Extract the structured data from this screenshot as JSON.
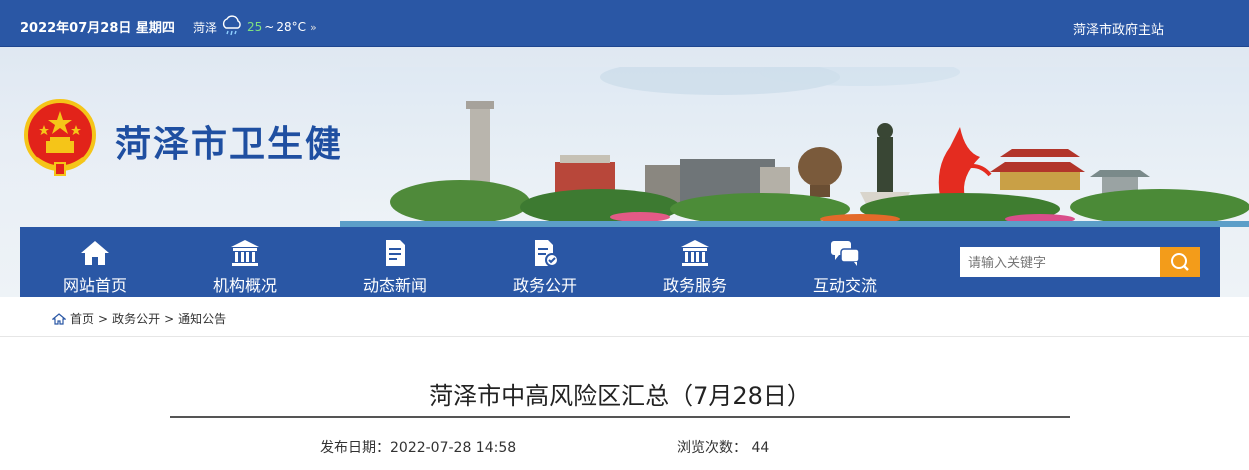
{
  "topbar": {
    "date": "2022年07月28日 星期四",
    "weather": {
      "city": "菏泽",
      "temp_low": "25",
      "tilde": "~",
      "temp_high": "28°C",
      "more": "»",
      "icon": "rain-cloud-icon"
    },
    "main_site_link": "菏泽市政府主站"
  },
  "header": {
    "site_title": "菏泽市卫生健康委员会",
    "emblem": "national-emblem"
  },
  "nav": {
    "items": [
      {
        "label": "网站首页",
        "icon": "home-icon"
      },
      {
        "label": "机构概况",
        "icon": "building-icon"
      },
      {
        "label": "动态新闻",
        "icon": "document-icon"
      },
      {
        "label": "政务公开",
        "icon": "document-check-icon"
      },
      {
        "label": "政务服务",
        "icon": "building-icon"
      },
      {
        "label": "互动交流",
        "icon": "chat-icon"
      }
    ],
    "search_placeholder": "请输入关键字",
    "search_icon": "search-icon"
  },
  "breadcrumb": {
    "items": [
      "首页",
      "政务公开",
      "通知公告"
    ],
    "separator": ">"
  },
  "article": {
    "title": "菏泽市中高风险区汇总（7月28日）",
    "publish_label": "发布日期：",
    "publish_date": "2022-07-28 14:58",
    "views_label": "浏览次数：",
    "views": "44"
  },
  "colors": {
    "primary_blue": "#2a57a5",
    "search_orange": "#f39c1a"
  }
}
